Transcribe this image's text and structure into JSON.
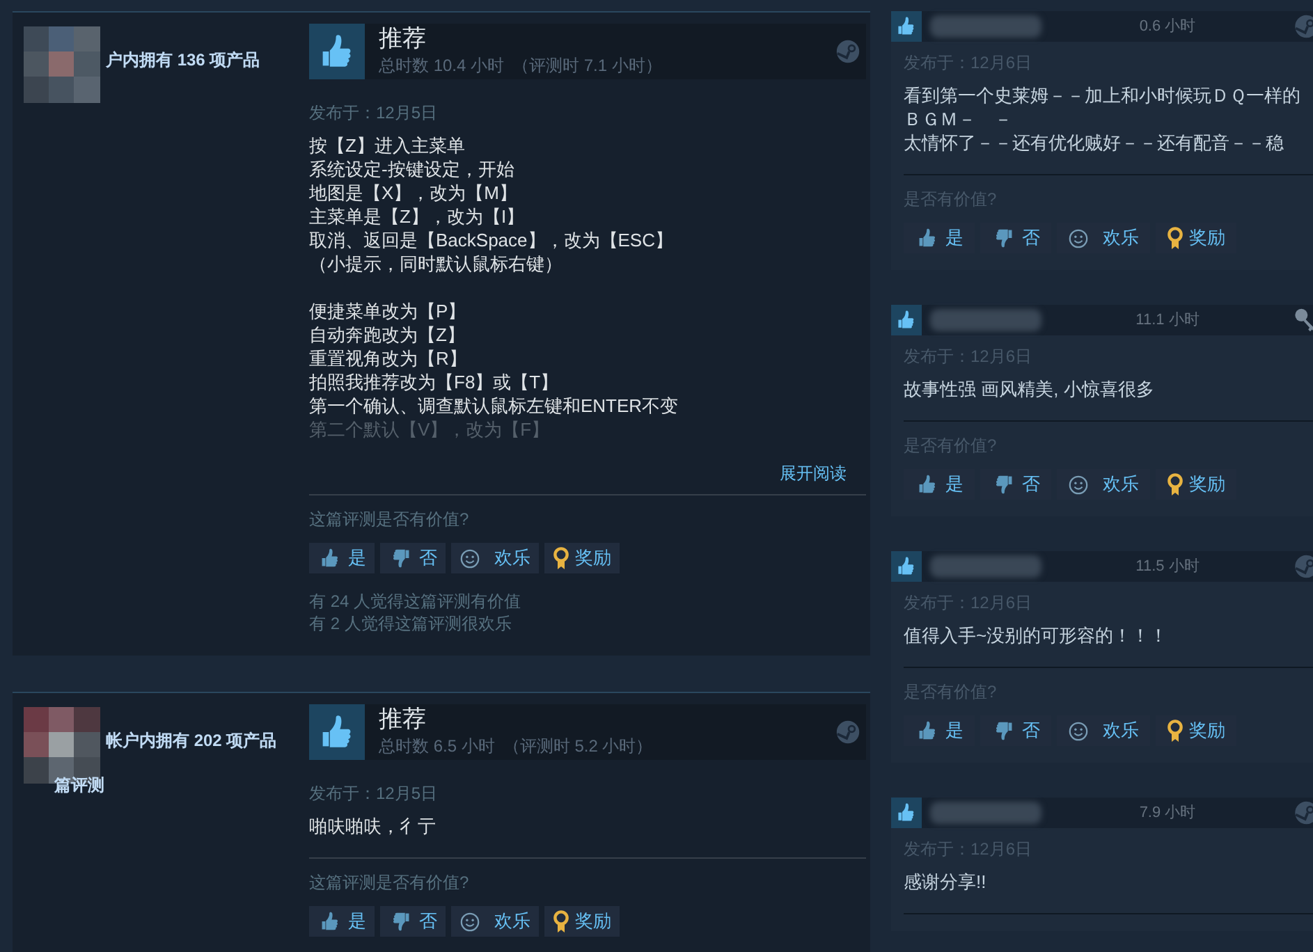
{
  "reviews": [
    {
      "author": {
        "products": "户内拥有 136 项产品"
      },
      "verdict": {
        "kind": "up",
        "label": "推荐"
      },
      "hours": "总时数 10.4 小时",
      "review_hours": "（评测时 7.1 小时）",
      "source": {
        "kind": "steam"
      },
      "posted": "发布于：12月5日",
      "paragraphs": [
        [
          "按【Z】进入主菜单",
          "系统设定-按键设定，开始",
          "地图是【X】，改为【M】",
          "主菜单是【Z】，改为【I】",
          "取消、返回是【BackSpace】，改为【ESC】",
          "（小提示，同时默认鼠标右键）"
        ],
        [
          "便捷菜单改为【P】",
          "自动奔跑改为【Z】",
          "重置视角改为【R】",
          "拍照我推荐改为【F8】或【T】",
          "第一个确认、调查默认鼠标左键和ENTER不变"
        ]
      ],
      "faded_line": "第二个默认【V】，改为【F】",
      "read_more": "展开阅读",
      "question": "这篇评测是否有价值?",
      "buttons": [
        {
          "kind": "yes",
          "label": "是"
        },
        {
          "kind": "no",
          "label": "否"
        },
        {
          "kind": "funny",
          "label": "欢乐"
        },
        {
          "kind": "award",
          "label": "奖励"
        }
      ],
      "stats": [
        "有 24 人觉得这篇评测有价值",
        "有 2 人觉得这篇评测很欢乐"
      ]
    },
    {
      "author": {
        "products": "帐户内拥有 202 项产品",
        "reviews": "篇评测"
      },
      "verdict": {
        "kind": "up",
        "label": "推荐"
      },
      "hours": "总时数 6.5 小时",
      "review_hours": "（评测时 5.2 小时）",
      "source": {
        "kind": "steam"
      },
      "posted": "发布于：12月5日",
      "paragraphs": [
        [
          "啪呋啪呋，彳亍"
        ]
      ],
      "question": "这篇评测是否有价值?",
      "buttons": [
        {
          "kind": "yes",
          "label": "是"
        },
        {
          "kind": "no",
          "label": "否"
        },
        {
          "kind": "funny",
          "label": "欢乐"
        },
        {
          "kind": "award",
          "label": "奖励"
        }
      ]
    }
  ],
  "side_reviews": [
    {
      "hours": "0.6 小时",
      "source": {
        "kind": "steam"
      },
      "posted": "发布于：12月6日",
      "lines": [
        "看到第一个史莱姆－－加上和小时候玩ＤＱ一样的ＢＧＭ－　－",
        "太情怀了－－还有优化贼好－－还有配音－－稳"
      ],
      "question": "是否有价值?",
      "buttons": [
        {
          "kind": "yes",
          "label": "是"
        },
        {
          "kind": "no",
          "label": "否"
        },
        {
          "kind": "funny",
          "label": "欢乐"
        },
        {
          "kind": "award",
          "label": "奖励"
        }
      ]
    },
    {
      "hours": "11.1 小时",
      "source": {
        "kind": "key"
      },
      "posted": "发布于：12月6日",
      "lines": [
        "故事性强 画风精美, 小惊喜很多"
      ],
      "question": "是否有价值?",
      "buttons": [
        {
          "kind": "yes",
          "label": "是"
        },
        {
          "kind": "no",
          "label": "否"
        },
        {
          "kind": "funny",
          "label": "欢乐"
        },
        {
          "kind": "award",
          "label": "奖励"
        }
      ]
    },
    {
      "hours": "11.5 小时",
      "source": {
        "kind": "steam"
      },
      "posted": "发布于：12月6日",
      "lines": [
        "值得入手~没别的可形容的！！！"
      ],
      "question": "是否有价值?",
      "buttons": [
        {
          "kind": "yes",
          "label": "是"
        },
        {
          "kind": "no",
          "label": "否"
        },
        {
          "kind": "funny",
          "label": "欢乐"
        },
        {
          "kind": "award",
          "label": "奖励"
        }
      ]
    },
    {
      "hours": "7.9 小时",
      "source": {
        "kind": "steam"
      },
      "posted": "发布于：12月6日",
      "lines": [
        "感谢分享!!"
      ]
    }
  ]
}
